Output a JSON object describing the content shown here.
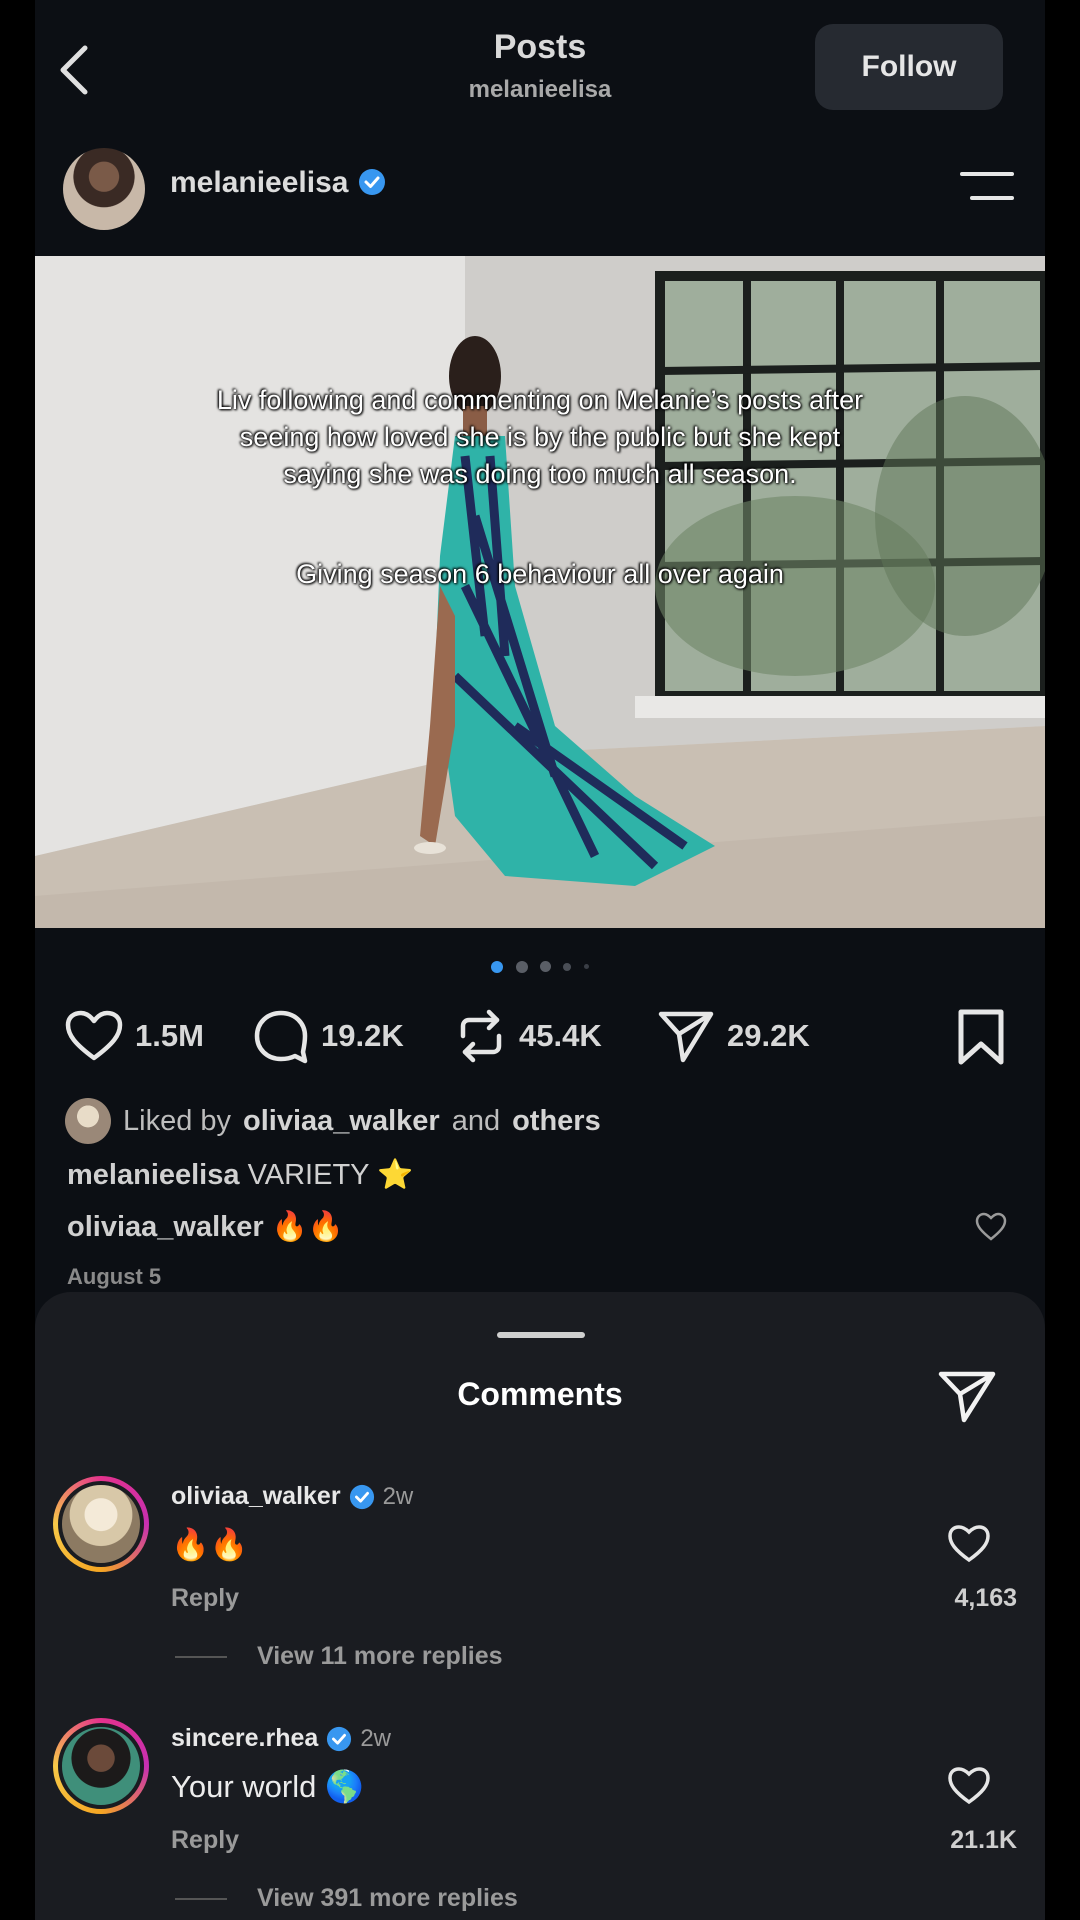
{
  "header": {
    "title": "Posts",
    "subtitle": "melanieelisa",
    "follow_label": "Follow"
  },
  "author": {
    "username": "melanieelisa"
  },
  "post": {
    "overlay_line1": "Liv following and commenting on Melanie’s posts after",
    "overlay_line2": "seeing how loved she is by the public but she kept",
    "overlay_line3": "saying she was doing too much all season.",
    "overlay_line4": "Giving season 6 behaviour all over again",
    "carousel_dots": 5,
    "carousel_active": 1
  },
  "actions": {
    "likes": "1.5M",
    "comments": "19.2K",
    "reposts": "45.4K",
    "shares": "29.2K"
  },
  "liked_by": {
    "prefix": "Liked by",
    "user": "oliviaa_walker",
    "middle": "and",
    "suffix": "others"
  },
  "caption": {
    "username": "melanieelisa",
    "text": "VARIETY ⭐"
  },
  "top_comment": {
    "username": "oliviaa_walker",
    "text": "🔥🔥"
  },
  "date": "August 5",
  "comments_sheet": {
    "title": "Comments",
    "comments": [
      {
        "username": "oliviaa_walker",
        "ago": "2w",
        "text": "🔥🔥",
        "reply_label": "Reply",
        "likes": "4,163",
        "more_replies": "View 11 more replies"
      },
      {
        "username": "sincere.rhea",
        "ago": "2w",
        "text": "Your world 🌎",
        "reply_label": "Reply",
        "likes": "21.1K",
        "more_replies": "View 391 more replies"
      }
    ]
  },
  "colors": {
    "verified_blue": "#3897f0",
    "story_ring": "#e4328d",
    "dress_teal": "#2fb3a8"
  }
}
